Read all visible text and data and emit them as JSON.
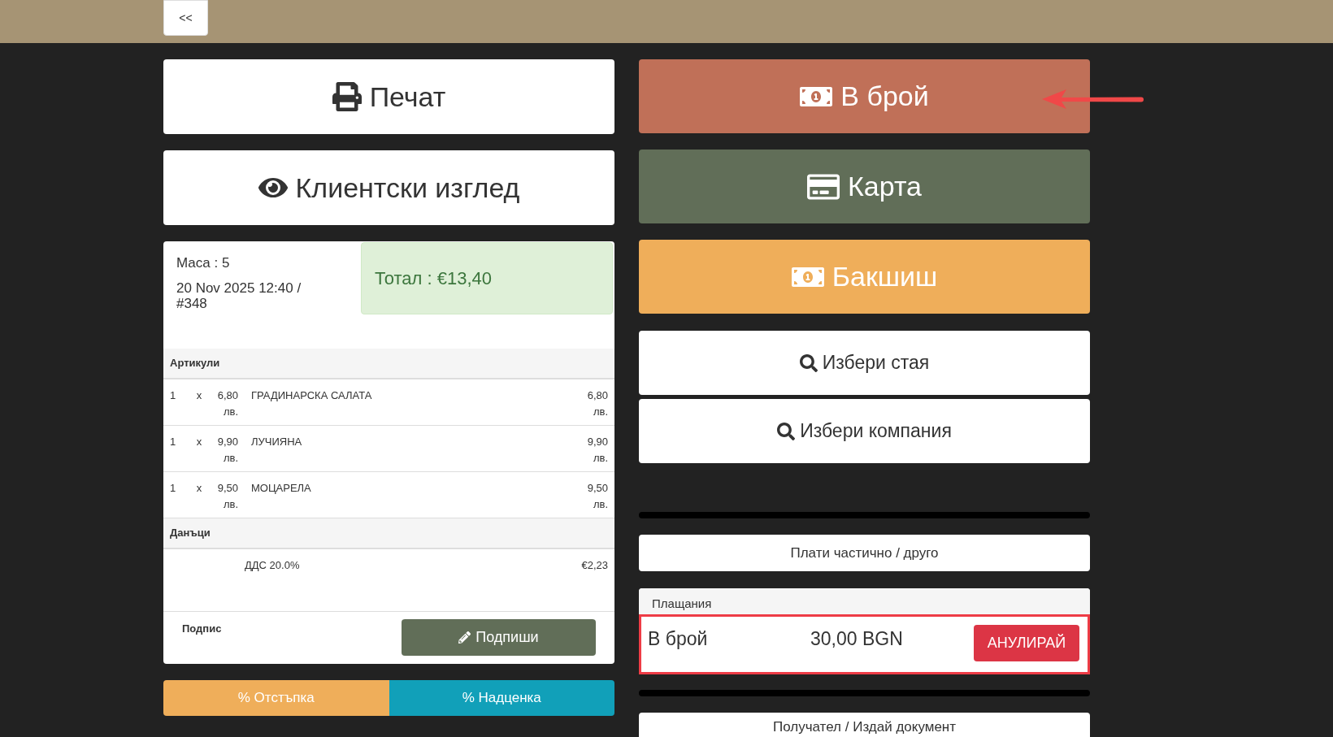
{
  "back_button": "<<",
  "actions": [
    {
      "kind": "print",
      "label": "Печат"
    },
    {
      "kind": "view",
      "label": "Клиентски изглед"
    }
  ],
  "receipt": {
    "table_label": "Маса : 5",
    "datetime": "20 Nov 2025 12:40 / #348",
    "total": "Тотал : €13,40",
    "items_heading": "Артикули",
    "items": [
      {
        "qty": "1",
        "times": "x",
        "price": "6,80 лв.",
        "name": "ГРАДИНАРСКА САЛАТА",
        "amount": "6,80 лв."
      },
      {
        "qty": "1",
        "times": "x",
        "price": "9,90 лв.",
        "name": "ЛУЧИЯНА",
        "amount": "9,90 лв."
      },
      {
        "qty": "1",
        "times": "x",
        "price": "9,50 лв.",
        "name": "МОЦАРЕЛА",
        "amount": "9,50 лв."
      }
    ],
    "taxes_heading": "Данъци",
    "taxes": [
      {
        "name": "ДДС 20.0%",
        "amount": "€2,23"
      }
    ],
    "signature_label": "Подпис",
    "sign_button": "Подпиши"
  },
  "adjust_buttons": [
    {
      "kind": "discount",
      "label": "% Отстъпка"
    },
    {
      "kind": "markup",
      "label": "% Надценка"
    }
  ],
  "payment_methods": [
    {
      "kind": "cash",
      "label": "В брой",
      "pointed": true
    },
    {
      "kind": "card",
      "label": "Карта",
      "pointed": false
    },
    {
      "kind": "tip",
      "label": "Бакшиш",
      "pointed": false
    }
  ],
  "search_buttons": [
    {
      "label": "Избери стая"
    },
    {
      "label": "Избери компания"
    }
  ],
  "partial_button": "Плати частично / друго",
  "payments": {
    "heading": "Плащания",
    "rows": [
      {
        "method": "В брой",
        "amount": "30,00 BGN",
        "cancel": "АНУЛИРАЙ",
        "highlighted": true
      }
    ]
  },
  "recipient_button": "Получател / Издай документ"
}
